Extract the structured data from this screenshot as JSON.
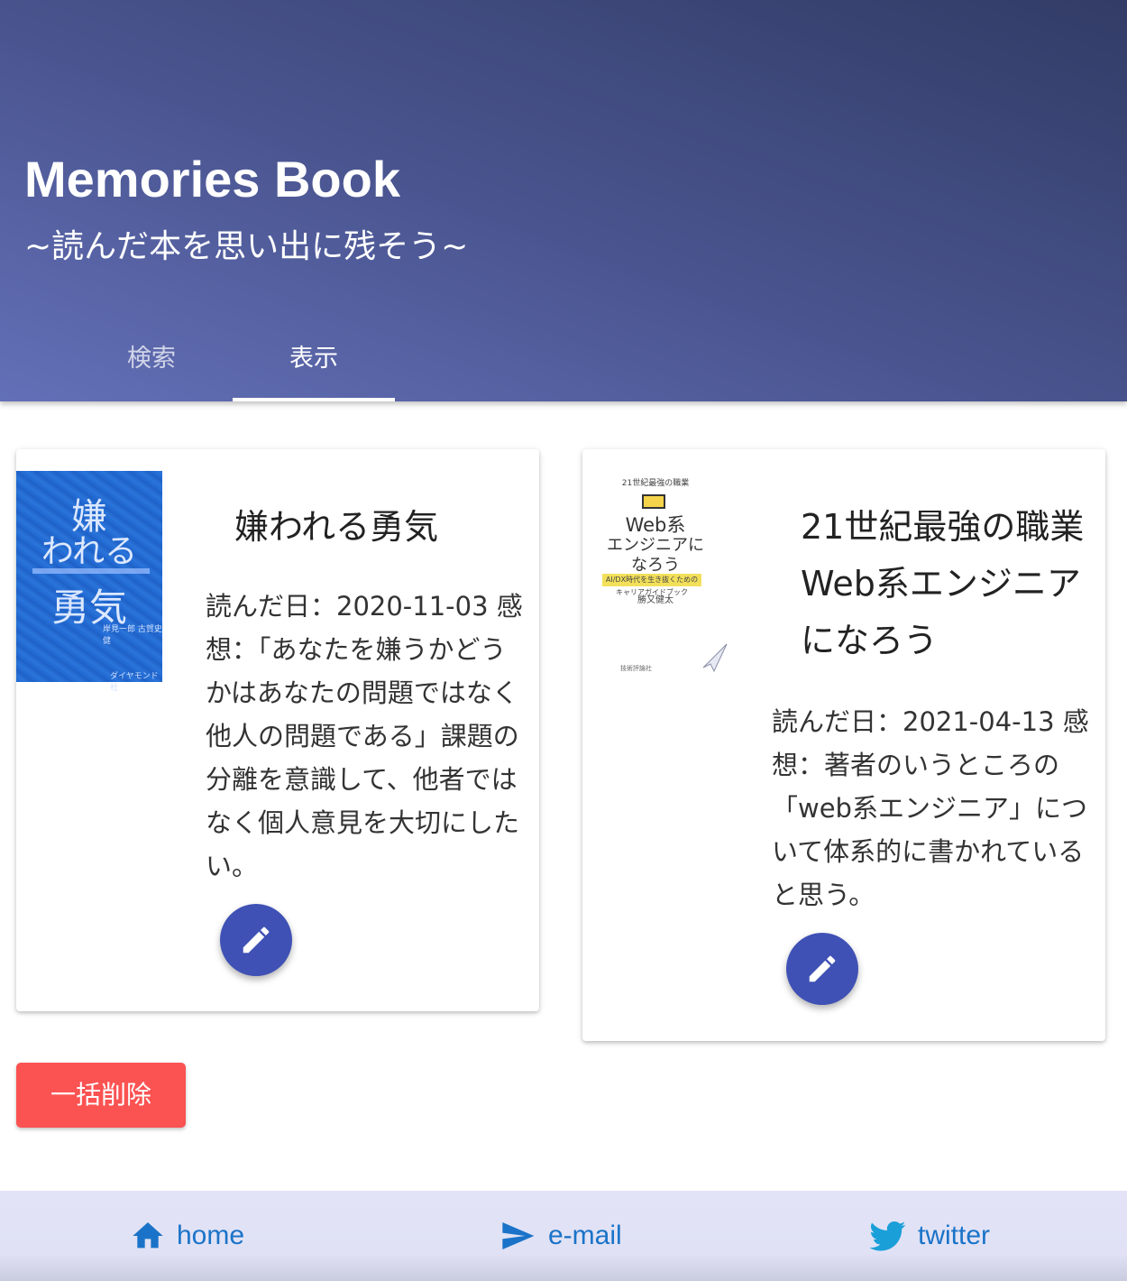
{
  "header": {
    "title": "Memories Book",
    "subtitle": "~読んだ本を思い出に残そう~",
    "tabs": [
      {
        "label": "検索",
        "active": false
      },
      {
        "label": "表示",
        "active": true
      }
    ],
    "gradient_colors": [
      "#323c66",
      "#6370b7"
    ]
  },
  "books": [
    {
      "title": "嫌われる勇気",
      "body": "読んだ日：2020-11-03 感想：「あなたを嫌うかどうかはあなたの問題ではなく他人の問題である」課題の分離を意識して、他者ではなく個人意見を大切にしたい。",
      "cover": {
        "lines": [
          "嫌",
          "われる",
          "勇気"
        ],
        "author": "岸見一郎 古賀史健",
        "publisher": "ダイヤモンド社",
        "color": "#1f66cf"
      },
      "edit_icon": "pencil-icon"
    },
    {
      "title": "21世紀最強の職業 Web系エンジニアになろう",
      "body": "読んだ日：2021-04-13 感想：著者のいうところの「web系エンジニア」について体系的に書かれていると思う。",
      "cover": {
        "top": "21世紀最強の職業",
        "lines": [
          "Web系",
          "エンジニアに",
          "なろう"
        ],
        "band": "AI/DX時代を生き抜くためのキャリアガイドブック",
        "author": "勝又健太",
        "publisher": "技術評論社"
      },
      "edit_icon": "pencil-icon"
    }
  ],
  "actions": {
    "bulk_delete_label": "一括削除",
    "bulk_delete_color": "#fb5252",
    "fab_color": "#3f51b5"
  },
  "footer": {
    "links": [
      {
        "label": "home",
        "icon": "home-icon"
      },
      {
        "label": "e-mail",
        "icon": "send-icon"
      },
      {
        "label": "twitter",
        "icon": "twitter-icon"
      }
    ],
    "link_color": "#1a73c8"
  }
}
